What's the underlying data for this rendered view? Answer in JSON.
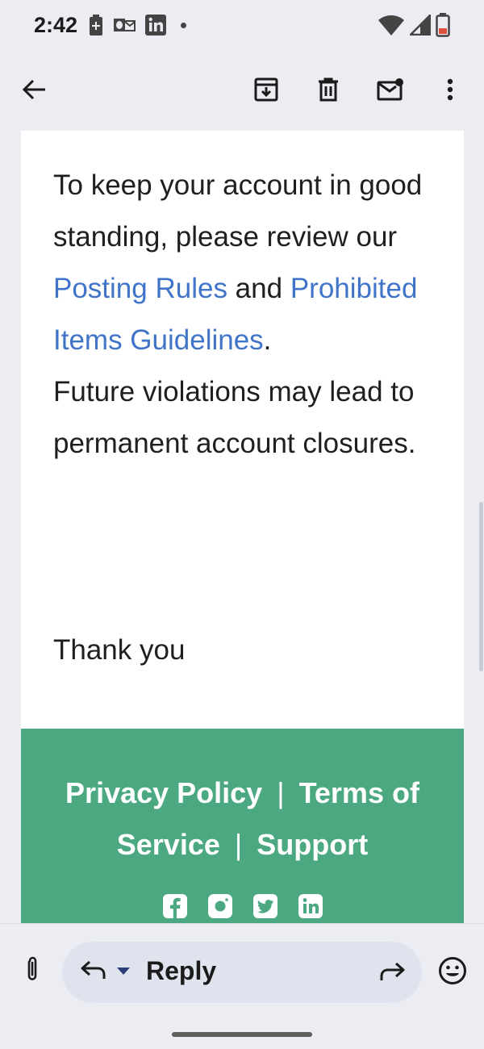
{
  "status_bar": {
    "time": "2:42"
  },
  "toolbar": {
    "back_icon": "arrow-back",
    "archive_icon": "archive",
    "delete_icon": "trash",
    "mark_unread_icon": "mail-unread",
    "more_icon": "more-vertical"
  },
  "email": {
    "para1_before": "To keep your account in good standing, please review our ",
    "link_posting_rules": "Posting Rules",
    "para1_and": " and ",
    "link_prohibited": "Prohibited Items Guidelines",
    "para1_end": ".",
    "para2": "Future violations may lead to permanent account closures.",
    "thanks": "Thank you"
  },
  "footer": {
    "privacy": "Privacy Policy",
    "terms": "Terms of Service",
    "support": "Support",
    "separator": "|",
    "social_icons": [
      "facebook-icon",
      "instagram-icon",
      "twitter-icon",
      "linkedin-icon"
    ],
    "background_color": "#4ba881"
  },
  "reply_bar": {
    "reply_label": "Reply",
    "link_color": "#3f74c9"
  }
}
